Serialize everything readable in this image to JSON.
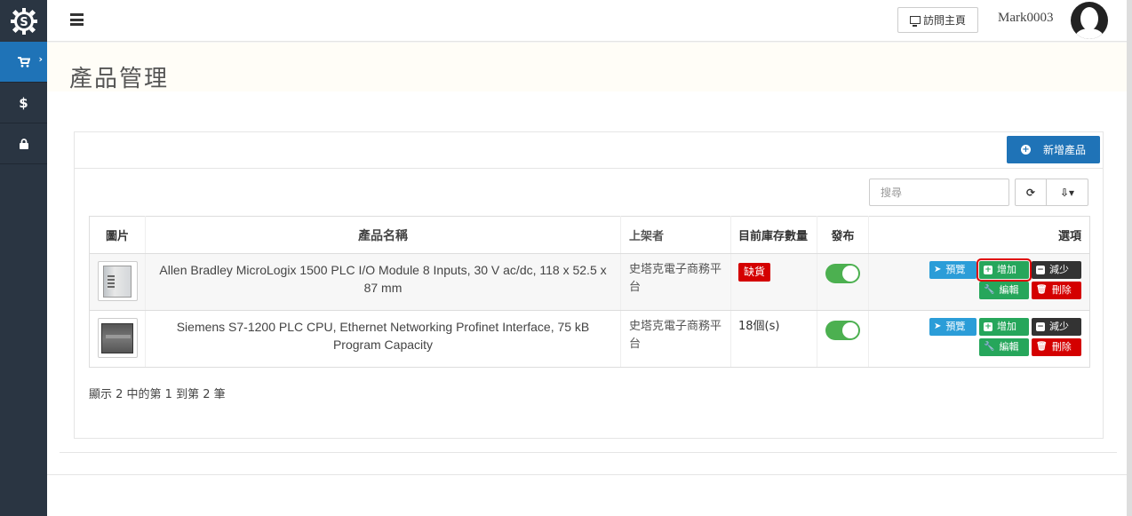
{
  "sidebar": {
    "items": [
      {
        "name": "cart",
        "icon": "cart-icon",
        "glyph": "🛒",
        "active": true
      },
      {
        "name": "finance",
        "icon": "dollar-icon",
        "glyph": "$"
      },
      {
        "name": "security",
        "icon": "lock-icon",
        "glyph": "🔒"
      }
    ],
    "active_color": "#1f73b7",
    "bg_color": "#2a3542"
  },
  "topbar": {
    "visit_label": "訪問主頁",
    "username": "Mark0003"
  },
  "page": {
    "title": "產品管理"
  },
  "panel": {
    "add_product_label": "新增產品",
    "search_placeholder": "搜尋",
    "refresh_glyph": "⟳",
    "export_glyph": "⇩▾"
  },
  "table": {
    "headers": {
      "image": "圖片",
      "name": "產品名稱",
      "seller": "上架者",
      "stock": "目前庫存數量",
      "publish": "發布",
      "options": "選項"
    },
    "rows": [
      {
        "name": "Allen Bradley MicroLogix 1500 PLC I/O Module 8 Inputs, 30 V ac/dc, 118 x 52.5 x 87 mm",
        "seller": "史塔克電子商務平台",
        "stock": "缺貨",
        "out_of_stock": true,
        "published": true
      },
      {
        "name": "Siemens S7-1200 PLC CPU, Ethernet Networking Profinet Interface, 75 kB Program Capacity",
        "seller": "史塔克電子商務平台",
        "stock": "18個(s)",
        "out_of_stock": false,
        "published": true
      }
    ],
    "buttons": {
      "preview": "預覽",
      "add": "增加",
      "reduce": "減少",
      "edit": "編輯",
      "delete": "刪除"
    }
  },
  "summary": "顯示 2 中的第 1 到第 2 筆"
}
